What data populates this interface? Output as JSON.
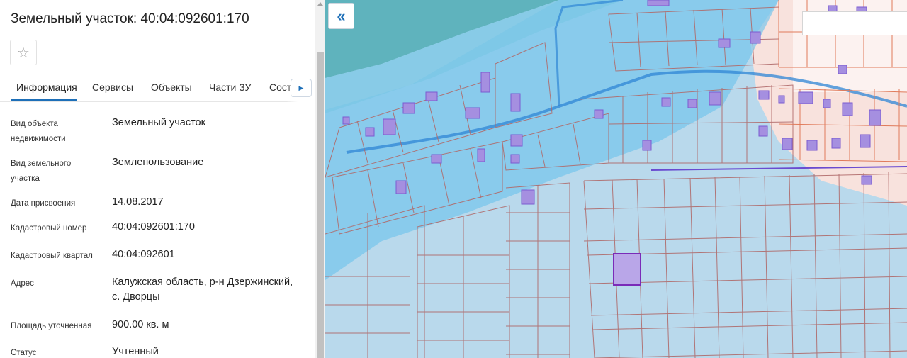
{
  "panel": {
    "title": "Земельный участок: 40:04:092601:170",
    "tabs": [
      {
        "label": "Информация"
      },
      {
        "label": "Сервисы"
      },
      {
        "label": "Объекты"
      },
      {
        "label": "Части ЗУ"
      },
      {
        "label": "Соста"
      }
    ],
    "rows": [
      {
        "label": "Вид объекта недвижимости",
        "value": "Земельный участок"
      },
      {
        "label": "Вид земельного участка",
        "value": "Землепользование"
      },
      {
        "label": "Дата присвоения",
        "value": "14.08.2017"
      },
      {
        "label": "Кадастровый номер",
        "value": "40:04:092601:170"
      },
      {
        "label": "Кадастровый квартал",
        "value": "40:04:092601"
      },
      {
        "label": "Адрес",
        "value": "Калужская область, р-н Дзержинский, с. Дворцы"
      },
      {
        "label": "Площадь уточненная",
        "value": "900.00 кв. м"
      },
      {
        "label": "Статус",
        "value": "Учтенный"
      }
    ]
  },
  "icons": {
    "favorite": "star-outline-icon",
    "tabs_next": "triangle-right-icon",
    "collapse": "double-chevron-left-icon"
  },
  "colors": {
    "accent": "#1d6fb8",
    "map_background": "#b9d9ec",
    "water_zone": "#6ec3ec",
    "river": "#5fb3bd",
    "parcel_lines": "#b06a6a",
    "selected_parcel": "#7a2bb8",
    "buildings": "#a58fe0",
    "residential_zone": "#fbe3dc"
  }
}
